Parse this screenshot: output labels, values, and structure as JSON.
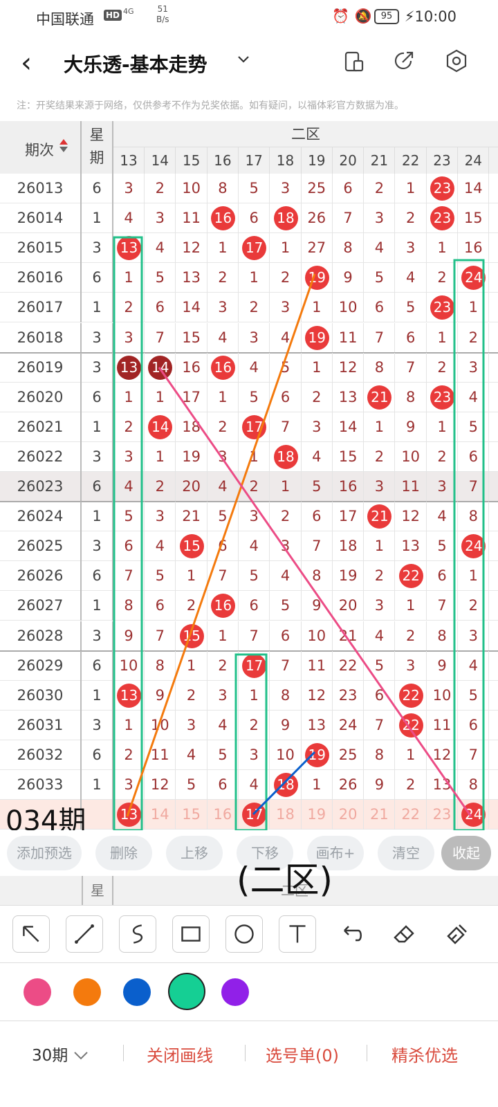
{
  "status_bar": {
    "carrier": "中国联通",
    "hd": "HD",
    "signal": "4G",
    "speed_value": "51",
    "speed_unit": "B/s",
    "battery": "95",
    "time": "10:00"
  },
  "header": {
    "title": "大乐透-基本走势",
    "dropdown_icon": "chevron-down-icon",
    "icons": [
      "phone-switch-icon",
      "share-icon",
      "settings-icon"
    ]
  },
  "notice": "注：开奖结果来源于网络，仅供参考不作为兑奖依据。如有疑问，以福体彩官方数据为准。",
  "table": {
    "period_header": "期次",
    "week_header_1": "星",
    "week_header_2": "期",
    "zone_title": "二区",
    "columns": [
      "13",
      "14",
      "15",
      "16",
      "17",
      "18",
      "19",
      "20",
      "21",
      "22",
      "23",
      "24"
    ],
    "rows": [
      {
        "period": "26013",
        "week": "6",
        "cells": [
          "3",
          "2",
          "10",
          "8",
          "5",
          "3",
          "25",
          "6",
          "2",
          "1",
          "23",
          "14"
        ],
        "hits": [
          10
        ]
      },
      {
        "period": "26014",
        "week": "1",
        "cells": [
          "4",
          "3",
          "11",
          "16",
          "6",
          "18",
          "26",
          "7",
          "3",
          "2",
          "23",
          "15"
        ],
        "hits": [
          3,
          5,
          10
        ]
      },
      {
        "period": "26015",
        "week": "3",
        "cells": [
          "13",
          "4",
          "12",
          "1",
          "17",
          "1",
          "27",
          "8",
          "4",
          "3",
          "1",
          "16"
        ],
        "hits": [
          0,
          4
        ]
      },
      {
        "period": "26016",
        "week": "6",
        "cells": [
          "1",
          "5",
          "13",
          "2",
          "1",
          "2",
          "19",
          "9",
          "5",
          "4",
          "2",
          "24"
        ],
        "hits": [
          6,
          11
        ]
      },
      {
        "period": "26017",
        "week": "1",
        "cells": [
          "2",
          "6",
          "14",
          "3",
          "2",
          "3",
          "1",
          "10",
          "6",
          "5",
          "23",
          "1"
        ],
        "hits": [
          10
        ]
      },
      {
        "period": "26018",
        "week": "3",
        "cells": [
          "3",
          "7",
          "15",
          "4",
          "3",
          "4",
          "19",
          "11",
          "7",
          "6",
          "1",
          "2"
        ],
        "hits": [
          6
        ]
      },
      {
        "period": "26019",
        "week": "3",
        "cells": [
          "13",
          "14",
          "16",
          "16",
          "4",
          "5",
          "1",
          "12",
          "8",
          "7",
          "2",
          "3"
        ],
        "hits": [
          0,
          1,
          3
        ],
        "dark": [
          0,
          1
        ]
      },
      {
        "period": "26020",
        "week": "6",
        "cells": [
          "1",
          "1",
          "17",
          "1",
          "5",
          "6",
          "2",
          "13",
          "21",
          "8",
          "23",
          "4"
        ],
        "hits": [
          8,
          10
        ]
      },
      {
        "period": "26021",
        "week": "1",
        "cells": [
          "2",
          "14",
          "18",
          "2",
          "17",
          "7",
          "3",
          "14",
          "1",
          "9",
          "1",
          "5"
        ],
        "hits": [
          1,
          4
        ]
      },
      {
        "period": "26022",
        "week": "3",
        "cells": [
          "3",
          "1",
          "19",
          "3",
          "1",
          "18",
          "4",
          "15",
          "2",
          "10",
          "2",
          "6"
        ],
        "hits": [
          5
        ]
      },
      {
        "period": "26023",
        "week": "6",
        "cells": [
          "4",
          "2",
          "20",
          "4",
          "2",
          "1",
          "5",
          "16",
          "3",
          "11",
          "3",
          "7"
        ],
        "hits": []
      },
      {
        "period": "26024",
        "week": "1",
        "cells": [
          "5",
          "3",
          "21",
          "5",
          "3",
          "2",
          "6",
          "17",
          "21",
          "12",
          "4",
          "8"
        ],
        "hits": [
          8
        ]
      },
      {
        "period": "26025",
        "week": "3",
        "cells": [
          "6",
          "4",
          "15",
          "6",
          "4",
          "3",
          "7",
          "18",
          "1",
          "13",
          "5",
          "24"
        ],
        "hits": [
          2,
          11
        ]
      },
      {
        "period": "26026",
        "week": "6",
        "cells": [
          "7",
          "5",
          "1",
          "7",
          "5",
          "4",
          "8",
          "19",
          "2",
          "22",
          "6",
          "1"
        ],
        "hits": [
          9
        ]
      },
      {
        "period": "26027",
        "week": "1",
        "cells": [
          "8",
          "6",
          "2",
          "16",
          "6",
          "5",
          "9",
          "20",
          "3",
          "1",
          "7",
          "2"
        ],
        "hits": [
          3
        ]
      },
      {
        "period": "26028",
        "week": "3",
        "cells": [
          "9",
          "7",
          "15",
          "1",
          "7",
          "6",
          "10",
          "21",
          "4",
          "2",
          "8",
          "3"
        ],
        "hits": [
          2
        ]
      },
      {
        "period": "26029",
        "week": "6",
        "cells": [
          "10",
          "8",
          "1",
          "2",
          "17",
          "7",
          "11",
          "22",
          "5",
          "3",
          "9",
          "4"
        ],
        "hits": [
          4
        ]
      },
      {
        "period": "26030",
        "week": "1",
        "cells": [
          "13",
          "9",
          "2",
          "3",
          "1",
          "8",
          "12",
          "23",
          "6",
          "22",
          "10",
          "5"
        ],
        "hits": [
          0,
          9
        ]
      },
      {
        "period": "26031",
        "week": "3",
        "cells": [
          "1",
          "10",
          "3",
          "4",
          "2",
          "9",
          "13",
          "24",
          "7",
          "22",
          "11",
          "6"
        ],
        "hits": [
          9
        ]
      },
      {
        "period": "26032",
        "week": "6",
        "cells": [
          "2",
          "11",
          "4",
          "5",
          "3",
          "10",
          "19",
          "25",
          "8",
          "1",
          "12",
          "7"
        ],
        "hits": [
          6
        ]
      },
      {
        "period": "26033",
        "week": "1",
        "cells": [
          "3",
          "12",
          "5",
          "6",
          "4",
          "18",
          "1",
          "26",
          "9",
          "2",
          "13",
          "8"
        ],
        "hits": [
          5
        ]
      }
    ],
    "prediction_row": {
      "cells": [
        "13",
        "14",
        "15",
        "16",
        "17",
        "18",
        "19",
        "20",
        "21",
        "22",
        "23",
        "24"
      ],
      "hits": [
        0,
        4,
        11
      ]
    }
  },
  "annotations": {
    "period_label": "034期",
    "zone_label": "(二区)"
  },
  "actions": [
    "添加预选",
    "删除",
    "上移",
    "下移",
    "画布+",
    "清空",
    "收起"
  ],
  "ghost_header": {
    "week": "星",
    "zone": "二区"
  },
  "tools": [
    "arrow-tool-icon",
    "line-tool-icon",
    "curve-tool-icon",
    "rectangle-tool-icon",
    "circle-tool-icon",
    "text-tool-icon",
    "undo-icon",
    "eraser-icon",
    "clear-brush-icon"
  ],
  "colors": [
    "#ec4c86",
    "#f47a0d",
    "#0a5fcc",
    "#15cf94",
    "#9120e8"
  ],
  "selected_color_index": 3,
  "bottom_bar": {
    "periods": "30期",
    "close_drawing": "关闭画线",
    "selection": "选号单(0)",
    "premium": "精杀优选"
  }
}
